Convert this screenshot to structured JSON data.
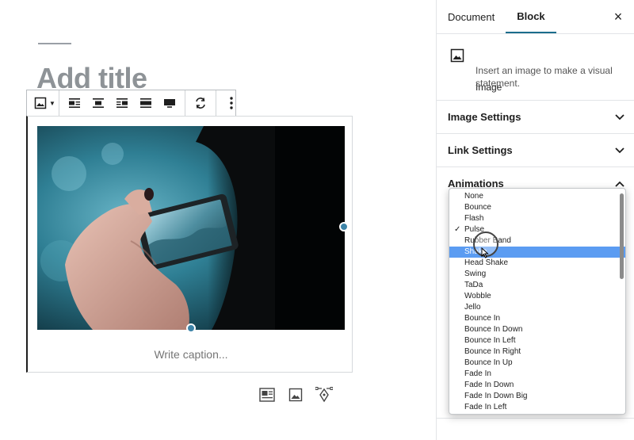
{
  "editor": {
    "title_placeholder": "Add title",
    "caption_placeholder": "Write caption...",
    "toolbar": {
      "groups": [
        [
          "image-icon",
          "chevron-down-icon"
        ],
        [
          "align-left-icon",
          "align-center-icon",
          "align-right-icon",
          "align-wide-icon",
          "align-full-icon"
        ],
        [
          "replace-icon"
        ],
        [
          "more-options-icon"
        ]
      ]
    },
    "bottom_icons": [
      "media-text-icon",
      "image-icon",
      "pen-tool-icon"
    ]
  },
  "sidebar": {
    "tabs": [
      "Document",
      "Block"
    ],
    "active_tab": "Block",
    "close_label": "×",
    "block": {
      "name": "Image",
      "description": "Insert an image to make a visual statement."
    },
    "panels": [
      {
        "label": "Image Settings",
        "expanded": false
      },
      {
        "label": "Link Settings",
        "expanded": false
      },
      {
        "label": "Animations",
        "expanded": true
      }
    ]
  },
  "animations_dropdown": {
    "options": [
      "None",
      "Bounce",
      "Flash",
      "Pulse",
      "Rubber Band",
      "Shake",
      "Head Shake",
      "Swing",
      "TaDa",
      "Wobble",
      "Jello",
      "Bounce In",
      "Bounce In Down",
      "Bounce In Left",
      "Bounce In Right",
      "Bounce In Up",
      "Fade In",
      "Fade In Down",
      "Fade In Down Big",
      "Fade In Left"
    ],
    "checked": "Pulse",
    "highlighted": "Shake",
    "checkmark": "✓"
  },
  "colors": {
    "accent": "#1b6d8c",
    "highlight": "#5b9cf2",
    "handle": "#3d84a8",
    "title_placeholder": "#8e9397"
  }
}
